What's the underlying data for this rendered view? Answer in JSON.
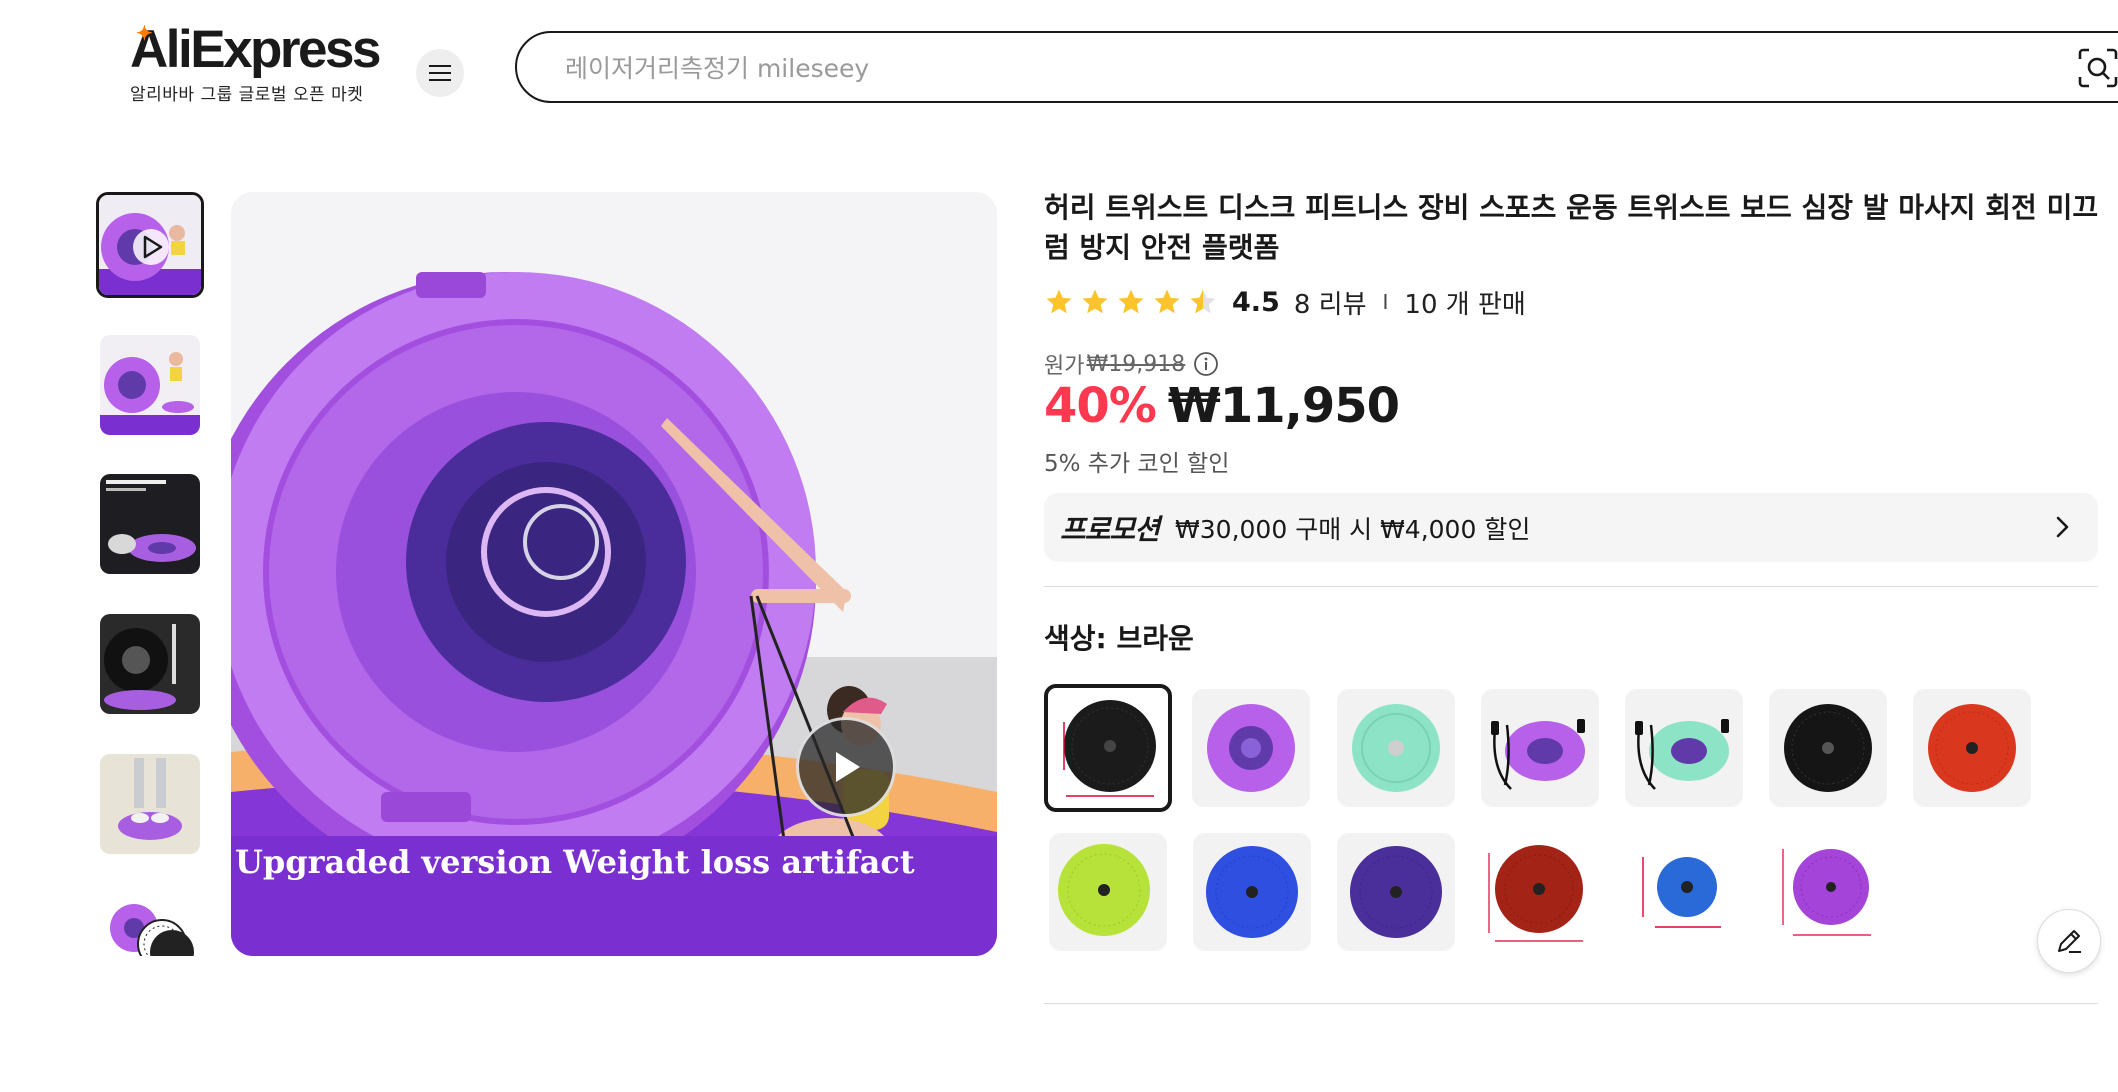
{
  "header": {
    "logo_text": "AliExpress",
    "logo_subtitle": "알리바바 그룹 글로벌 오픈 마켓",
    "menu_icon": "hamburger-icon",
    "search_placeholder": "레이저거리측정기 mileseey",
    "search_icon": "camera-search-icon"
  },
  "gallery": {
    "thumbnail_count": 6,
    "selected_index": 0,
    "main_caption": "Upgraded version Weight loss artifact",
    "play_icon": "play-icon"
  },
  "product": {
    "title": "허리 트위스트 디스크 피트니스 장비 스포츠 운동 트위스트 보드 심장 발 마사지 회전 미끄럼 방지 안전 플랫폼",
    "rating_value": "4.5",
    "rating_stars": 4.5,
    "review_count": "8 리뷰",
    "separator": "I",
    "sold_count": "10 개 판매",
    "original_label": "원가",
    "original_price": "₩19,918",
    "discount": "40%",
    "price": "₩11,950",
    "coin_discount": "5% 추가 코인 할인",
    "promo_tag": "프로모션",
    "promo_text": "₩30,000 구매 시 ₩4,000 할인",
    "color_label": "색상: 브라운",
    "selected_color_index": 0,
    "swatch_count": 13
  },
  "colors": {
    "accent_red": "#fd384f",
    "text": "#191919",
    "logo_orange": "#ff7a00",
    "product_purple": "#b760ea",
    "banner_purple": "#7a2fd0"
  }
}
